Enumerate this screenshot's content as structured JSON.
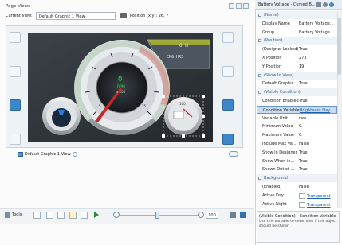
{
  "page_views": {
    "title": "Page Views",
    "current_view_label": "Current View:",
    "current_view_value": "Default Graphic 1 View",
    "position_label": "Position (x,y): 26, 7",
    "view_tab_label": "Default Graphic 1 View"
  },
  "gauge": {
    "units_top": "0 H",
    "units_bottom": "ENG HRS",
    "center_value": "0",
    "center_unit": "RPM",
    "center_scale": "x 100",
    "scale_labels": [
      "5",
      "10",
      "15",
      "20",
      "25"
    ],
    "left_scale": [
      "100",
      "1000"
    ],
    "right_scale": [
      "100",
      "1000"
    ],
    "right_top_value": "100"
  },
  "bottom_toolbar": {
    "tools_label": "Tools",
    "zoom_value": "100"
  },
  "properties": {
    "title": "Battery Voltage - Curved B...",
    "rows": [
      {
        "type": "cat",
        "name": "(Name)"
      },
      {
        "type": "row",
        "name": "Display Name",
        "value": "Battery Voltage..."
      },
      {
        "type": "row",
        "name": "Group",
        "value": "Battery Voltage"
      },
      {
        "type": "cat",
        "name": "(Position)"
      },
      {
        "type": "row",
        "name": "(Designer Locked)",
        "value": "True"
      },
      {
        "type": "row",
        "name": "X Position",
        "value": "273"
      },
      {
        "type": "row",
        "name": "Y Position",
        "value": "19"
      },
      {
        "type": "cat",
        "name": "(Show In View)"
      },
      {
        "type": "row",
        "name": "Default Graphic...",
        "value": "True"
      },
      {
        "type": "cat",
        "name": "(Visible Condition)"
      },
      {
        "type": "row",
        "name": "Condition Enabled",
        "value": "True"
      },
      {
        "type": "row",
        "name": "Condition Variable",
        "value": "Brightness.Day",
        "selected": true,
        "link": true
      },
      {
        "type": "row",
        "name": "Variable Unit",
        "value": "raw"
      },
      {
        "type": "row",
        "name": "Minimum Value",
        "value": "0."
      },
      {
        "type": "row",
        "name": "Maximum Value",
        "value": "0."
      },
      {
        "type": "row",
        "name": "Include Max Va...",
        "value": "False"
      },
      {
        "type": "row",
        "name": "Show in Designer",
        "value": "True"
      },
      {
        "type": "row",
        "name": "Show When in...",
        "value": "True"
      },
      {
        "type": "row",
        "name": "Shown Out of ...",
        "value": "True"
      },
      {
        "type": "cat",
        "name": "Background"
      },
      {
        "type": "row",
        "name": "(Enabled)",
        "value": "False"
      },
      {
        "type": "row",
        "name": "Active Day",
        "value": "Transparent",
        "swatch": true
      },
      {
        "type": "row",
        "name": "Active Night",
        "value": "Transparent",
        "swatch": true
      }
    ],
    "desc_title": "(Visible Condition) - Condition Variable",
    "desc_text": "Use this variable to determine if this object should be shown"
  }
}
